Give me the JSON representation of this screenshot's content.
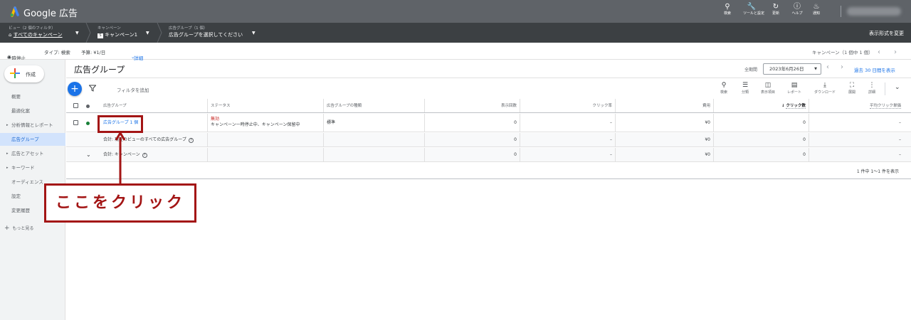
{
  "topbar": {
    "brand": "Google 広告",
    "icons": [
      {
        "icon": "search-icon",
        "label": "検索"
      },
      {
        "icon": "tools-icon",
        "label": "ツールと設定"
      },
      {
        "icon": "refresh-icon",
        "label": "更新"
      },
      {
        "icon": "help-icon",
        "label": "ヘルプ"
      },
      {
        "icon": "bell-icon",
        "label": "通知"
      }
    ]
  },
  "breadcrumb": {
    "view_small": "ビュー（2 個のフィルタ）",
    "view_main": "すべてのキャンペーン",
    "campaign_small": "キャンペーン",
    "campaign_badge": "S",
    "campaign_main": "キャンペーン1",
    "adgroup_small": "広告グループ（1 個）",
    "adgroup_main": "広告グループを選択してください",
    "view_mode": "表示形式を変更"
  },
  "infobar": {
    "status": "一時停止",
    "type": "タイプ: 検索",
    "budget": "予算: ¥1/日",
    "details": "詳細",
    "campaign_pager": "キャンペーン（1 個中 1 個）"
  },
  "sidebar": {
    "create": "作成",
    "items": [
      {
        "label": "概要",
        "expandable": false,
        "active": false
      },
      {
        "label": "最適化案",
        "expandable": false,
        "active": false
      },
      {
        "label": "分析情報とレポート",
        "expandable": true,
        "active": false
      },
      {
        "label": "広告グループ",
        "expandable": false,
        "active": true
      },
      {
        "label": "広告とアセット",
        "expandable": true,
        "active": false
      },
      {
        "label": "キーワード",
        "expandable": true,
        "active": false
      },
      {
        "label": "オーディエンス",
        "expandable": false,
        "active": false
      },
      {
        "label": "設定",
        "expandable": false,
        "active": false
      },
      {
        "label": "変更履歴",
        "expandable": false,
        "active": false
      }
    ],
    "more": "もっと見る"
  },
  "page": {
    "title": "広告グループ",
    "date_range_label": "全期間",
    "date_value": "2023年6月26日",
    "date_preset": "過去 30 日間を表示",
    "filter_placeholder": "フィルタを追加"
  },
  "toolbar": [
    {
      "icon": "search-icon",
      "label": "検索"
    },
    {
      "icon": "segment-icon",
      "label": "分類"
    },
    {
      "icon": "columns-icon",
      "label": "表示項目"
    },
    {
      "icon": "report-icon",
      "label": "レポート"
    },
    {
      "icon": "download-icon",
      "label": "ダウンロード"
    },
    {
      "icon": "expand-icon",
      "label": "展開"
    },
    {
      "icon": "more-icon",
      "label": "詳細"
    }
  ],
  "table": {
    "headers": {
      "adgroup": "広告グループ",
      "status": "ステータス",
      "type": "広告グループの種類",
      "impressions": "表示回数",
      "ctr": "クリック率",
      "cost": "費用",
      "clicks": "クリック数",
      "avg_cpc": "平均クリック単価"
    },
    "rows": [
      {
        "name": "広告グループ 1 個",
        "status_line1": "無効",
        "status_line2": "キャンペーン一時停止中、キャンペーン保留中",
        "type": "標準",
        "impressions": "0",
        "ctr": "–",
        "cost": "¥0",
        "clicks": "0",
        "avg_cpc": "–"
      }
    ],
    "totals": [
      {
        "label": "合計: 現在のビューのすべての広告グループ",
        "impressions": "0",
        "ctr": "–",
        "cost": "¥0",
        "clicks": "0",
        "avg_cpc": "–"
      },
      {
        "label": "合計: キャンペーン",
        "impressions": "0",
        "ctr": "–",
        "cost": "¥0",
        "clicks": "0",
        "avg_cpc": "–"
      }
    ],
    "pagination": "1 件中 1〜1 件を表示"
  },
  "annotation": {
    "callout": "ここをクリック",
    "color": "#a31515"
  },
  "colors": {
    "accent": "#1a73e8",
    "topbar": "#5f6368",
    "breadcrumb_bar": "#3c4043",
    "enabled_dot": "#188038"
  }
}
